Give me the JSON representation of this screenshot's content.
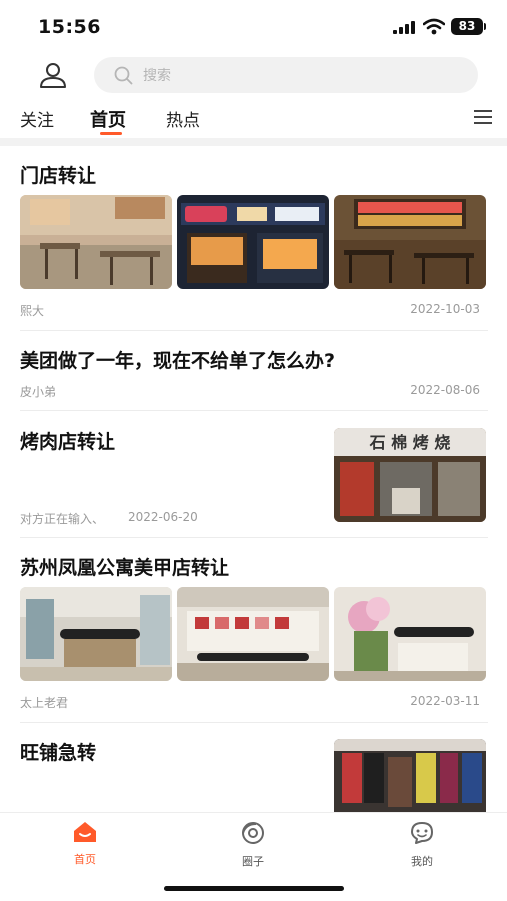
{
  "status": {
    "time": "15:56",
    "battery": "83"
  },
  "search": {
    "placeholder": "搜索"
  },
  "tabs": [
    {
      "label": "关注",
      "active": false
    },
    {
      "label": "首页",
      "active": true
    },
    {
      "label": "热点",
      "active": false
    }
  ],
  "feed": [
    {
      "title": "门店转让",
      "author": "熙大",
      "date": "2022-10-03"
    },
    {
      "title": "美团做了一年，现在不给单了怎么办?",
      "author": "皮小弟",
      "date": "2022-08-06"
    },
    {
      "title": "烤肉店转让",
      "author": "对方正在输入、",
      "date": "2022-06-20",
      "sign_text": "石 棉 烤 烧"
    },
    {
      "title": "苏州凤凰公寓美甲店转让",
      "author": "太上老君",
      "date": "2022-03-11"
    },
    {
      "title": "旺铺急转"
    }
  ],
  "bottom_nav": [
    {
      "label": "首页",
      "icon": "home-icon",
      "active": true
    },
    {
      "label": "圈子",
      "icon": "circle-icon",
      "active": false
    },
    {
      "label": "我的",
      "icon": "chat-icon",
      "active": false
    }
  ],
  "colors": {
    "accent": "#ff5a2a",
    "text": "#111111",
    "meta": "#9a9a9a"
  }
}
